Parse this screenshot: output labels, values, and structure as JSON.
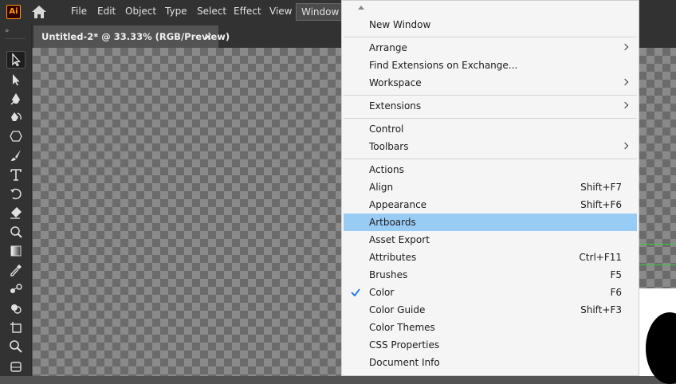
{
  "app": {
    "logo_text": "Ai"
  },
  "menubar": {
    "items": [
      "File",
      "Edit",
      "Object",
      "Type",
      "Select",
      "Effect",
      "View",
      "Window"
    ],
    "active": "Window"
  },
  "document": {
    "tab_title": "Untitled-2* @ 33.33% (RGB/Preview)",
    "close_glyph": "×"
  },
  "toolbar": {
    "tools": [
      "selection-tool",
      "direct-selection-tool",
      "pen-tool",
      "curvature-tool",
      "shape-tool",
      "paintbrush-tool",
      "type-tool",
      "rotate-tool",
      "eraser-tool",
      "warp-tool",
      "gradient-tool",
      "eyedropper-tool",
      "blend-tool",
      "shape-builder-tool",
      "artboard-tool",
      "zoom-tool",
      "hand-tool"
    ],
    "selected": "selection-tool"
  },
  "window_menu": {
    "items": [
      {
        "label": "New Window",
        "shortcut": "",
        "submenu": false
      },
      {
        "label": "Arrange",
        "shortcut": "",
        "submenu": true
      },
      {
        "label": "Find Extensions on Exchange...",
        "shortcut": "",
        "submenu": false
      },
      {
        "label": "Workspace",
        "shortcut": "",
        "submenu": true
      },
      {
        "label": "Extensions",
        "shortcut": "",
        "submenu": true
      },
      {
        "label": "Control",
        "shortcut": "",
        "submenu": false
      },
      {
        "label": "Toolbars",
        "shortcut": "",
        "submenu": true
      },
      {
        "label": "Actions",
        "shortcut": "",
        "submenu": false
      },
      {
        "label": "Align",
        "shortcut": "Shift+F7",
        "submenu": false
      },
      {
        "label": "Appearance",
        "shortcut": "Shift+F6",
        "submenu": false
      },
      {
        "label": "Artboards",
        "shortcut": "",
        "submenu": false,
        "highlighted": true
      },
      {
        "label": "Asset Export",
        "shortcut": "",
        "submenu": false
      },
      {
        "label": "Attributes",
        "shortcut": "Ctrl+F11",
        "submenu": false
      },
      {
        "label": "Brushes",
        "shortcut": "F5",
        "submenu": false
      },
      {
        "label": "Color",
        "shortcut": "F6",
        "submenu": false,
        "checked": true
      },
      {
        "label": "Color Guide",
        "shortcut": "Shift+F3",
        "submenu": false
      },
      {
        "label": "Color Themes",
        "shortcut": "",
        "submenu": false
      },
      {
        "label": "CSS Properties",
        "shortcut": "",
        "submenu": false
      },
      {
        "label": "Document Info",
        "shortcut": "",
        "submenu": false
      }
    ]
  },
  "colors": {
    "highlight": "#99ccf5",
    "check": "#1473e6",
    "app_accent": "#ff9a00",
    "guide": "#3ec43e"
  }
}
